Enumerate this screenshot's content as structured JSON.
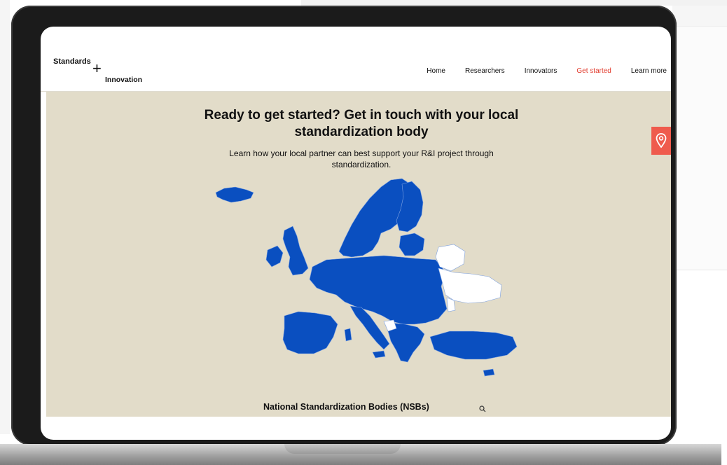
{
  "site": {
    "logo": {
      "line1": "Standards",
      "plus": "+",
      "line2": "Innovation"
    },
    "nav": [
      {
        "label": "Home",
        "active": false
      },
      {
        "label": "Researchers",
        "active": false
      },
      {
        "label": "Innovators",
        "active": false
      },
      {
        "label": "Get started",
        "active": true
      },
      {
        "label": "Learn more",
        "active": false
      }
    ]
  },
  "hero": {
    "title": "Ready to get started? Get in touch with your local standardization body",
    "subtitle": "Learn how your local partner can best support your R&I project through standardization."
  },
  "nsb": {
    "label": "National Standardization Bodies (NSBs)"
  },
  "icons": {
    "pin": "location-pin-icon",
    "search": "search-icon"
  },
  "colors": {
    "accent": "#e23d2f",
    "pin_tab": "#ef5b4d",
    "content_bg": "#e2dcc9",
    "map_member": "#0a4fc0",
    "map_non_member": "#ffffff"
  }
}
